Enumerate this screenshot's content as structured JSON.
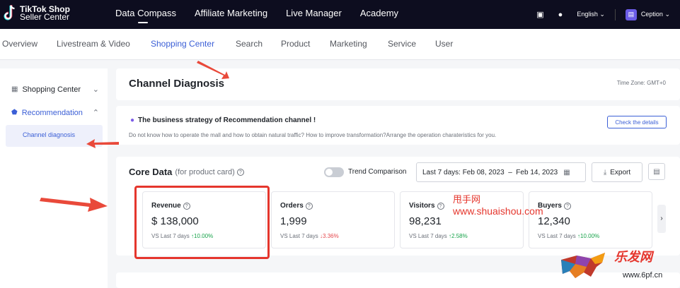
{
  "topbar": {
    "logo_line1": "TikTok Shop",
    "logo_line2": "Seller Center",
    "nav": [
      "Data Compass",
      "Affiliate Marketing",
      "Live Manager",
      "Academy"
    ],
    "language": "English",
    "username": "Ception"
  },
  "subnav": [
    "Overview",
    "Livestream & Video",
    "Shopping Center",
    "Search",
    "Product",
    "Marketing",
    "Service",
    "User"
  ],
  "sidebar": {
    "items": [
      {
        "label": "Shopping Center"
      },
      {
        "label": "Recommendation"
      }
    ],
    "sub_item": "Channel diagnosis"
  },
  "header": {
    "title": "Channel Diagnosis",
    "timezone": "Time Zone: GMT+0"
  },
  "banner": {
    "title": "The business strategy of Recommendation channel !",
    "desc": "Do not know how to operate the mall and how to obtain natural traffic? How to improve transformation?Arrange the operation charateristics for you.",
    "button": "Check the details"
  },
  "core": {
    "title": "Core Data",
    "subtitle": "(for product card)",
    "trend_label": "Trend Comparison",
    "date_range": "Last 7 days: Feb 08, 2023  –  Feb 14, 2023",
    "export": "Export",
    "metrics": [
      {
        "label": "Revenue",
        "value": "$ 138,000",
        "cmp": "VS Last 7 days",
        "change": "10.00%",
        "dir": "up"
      },
      {
        "label": "Orders",
        "value": "1,999",
        "cmp": "VS Last 7 days",
        "change": "3.36%",
        "dir": "down"
      },
      {
        "label": "Visitors",
        "value": "98,231",
        "cmp": "VS Last 7 days",
        "change": "2.58%",
        "dir": "up"
      },
      {
        "label": "Buyers",
        "value": "12,340",
        "cmp": "VS Last 7 days",
        "change": "10.00%",
        "dir": "up"
      }
    ]
  },
  "watermark": {
    "line1": "甩手网",
    "line2": "www.shuaishou.com",
    "corner1": "乐发网",
    "corner2": "www.6pf.cn"
  },
  "colors": {
    "accent": "#3b5fd6",
    "highlight": "#e5362d",
    "topbar": "#0d0d1f"
  }
}
